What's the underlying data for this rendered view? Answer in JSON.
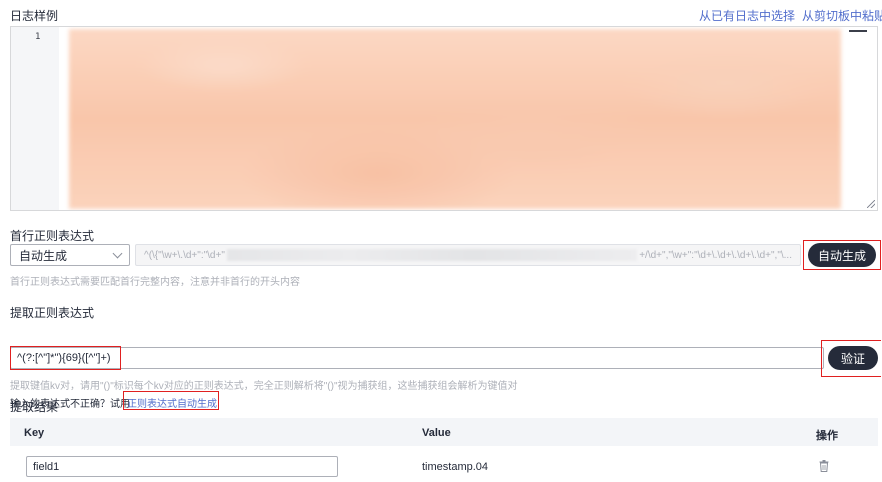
{
  "log_sample": {
    "title": "日志样例",
    "from_logs_link": "从已有日志中选择",
    "from_clipboard_link": "从剪切板中粘贴",
    "line_number": "1"
  },
  "first_line": {
    "title": "首行正则表达式",
    "mode_selected": "自动生成",
    "regex_prefix": "^(\\{\"\\w+\\.\\d+\":\"\\d+\"",
    "regex_suffix": "+/\\d+\",\"\\w+\":\"\\d+\\.\\d+\\.\\d+\\.\\d+\",\"\\...",
    "auto_generate_button": "自动生成",
    "hint": "首行正则表达式需要匹配首行完整内容，注意并非首行的开头内容"
  },
  "extract": {
    "title": "提取正则表达式",
    "regex_value": "^(?:[^\"]*\"){69}([^\"]+)",
    "verify_button": "验证",
    "hint": "提取键值kv对，请用\"()\"标识每个kv对应的正则表达式，完全正则解析将\"()\"视为捕获组，这些捕获组会解析为键值对",
    "incorrect_prompt": "输入的表达式不正确？试用",
    "auto_generate_link": "正则表达式自动生成"
  },
  "results": {
    "title": "提取结果",
    "columns": {
      "key": "Key",
      "value": "Value",
      "action": "操作"
    },
    "rows": [
      {
        "key": "field1",
        "value": "timestamp.04"
      }
    ]
  },
  "colors": {
    "link": "#526ecc",
    "button_dark": "#252b3a",
    "highlight_red": "#e02020"
  }
}
